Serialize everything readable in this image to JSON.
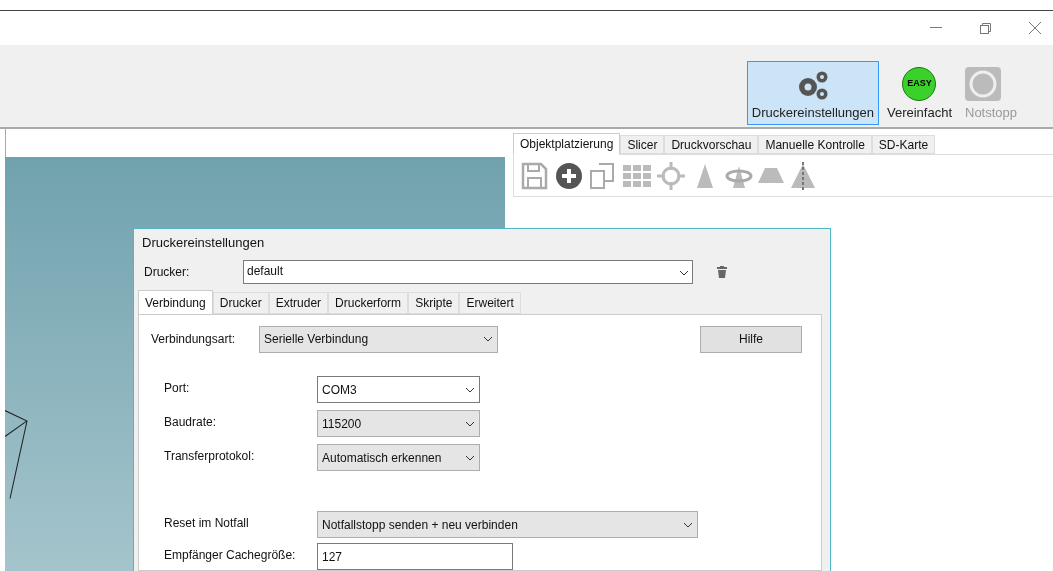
{
  "toolbar": {
    "buttons": [
      {
        "kind": "settings",
        "label": "Druckereinstellungen",
        "selected": true,
        "disabled": false
      },
      {
        "kind": "easy",
        "label": "Vereinfacht",
        "badge": "EASY",
        "selected": false,
        "disabled": false
      },
      {
        "kind": "stop",
        "label": "Notstopp",
        "selected": false,
        "disabled": true
      }
    ]
  },
  "right_panel": {
    "tabs": [
      {
        "label": "Objektplatzierung",
        "selected": true
      },
      {
        "label": "Slicer",
        "selected": false
      },
      {
        "label": "Druckvorschau",
        "selected": false
      },
      {
        "label": "Manuelle Kontrolle",
        "selected": false
      },
      {
        "label": "SD-Karte",
        "selected": false
      }
    ]
  },
  "dialog": {
    "title": "Druckereinstellungen",
    "printer": {
      "label": "Drucker:",
      "value": "default"
    },
    "tabs": [
      {
        "label": "Verbindung",
        "selected": true
      },
      {
        "label": "Drucker",
        "selected": false
      },
      {
        "label": "Extruder",
        "selected": false
      },
      {
        "label": "Druckerform",
        "selected": false
      },
      {
        "label": "Skripte",
        "selected": false
      },
      {
        "label": "Erweitert",
        "selected": false
      }
    ],
    "connection_type": {
      "label": "Verbindungsart:",
      "value": "Serielle Verbindung"
    },
    "help_button": "Hilfe",
    "groups": [
      [
        {
          "label": "Port:",
          "value": "COM3",
          "kind": "combo"
        },
        {
          "label": "Baudrate:",
          "value": "115200",
          "kind": "dropdown"
        },
        {
          "label": "Transferprotokol:",
          "value": "Automatisch erkennen",
          "kind": "dropdown"
        }
      ],
      [
        {
          "label": "Reset im Notfall",
          "value": "Notfallstopp senden + neu verbinden",
          "kind": "dropdown"
        },
        {
          "label": "Empfänger Cachegröße:",
          "value": "127",
          "kind": "input"
        }
      ]
    ]
  }
}
